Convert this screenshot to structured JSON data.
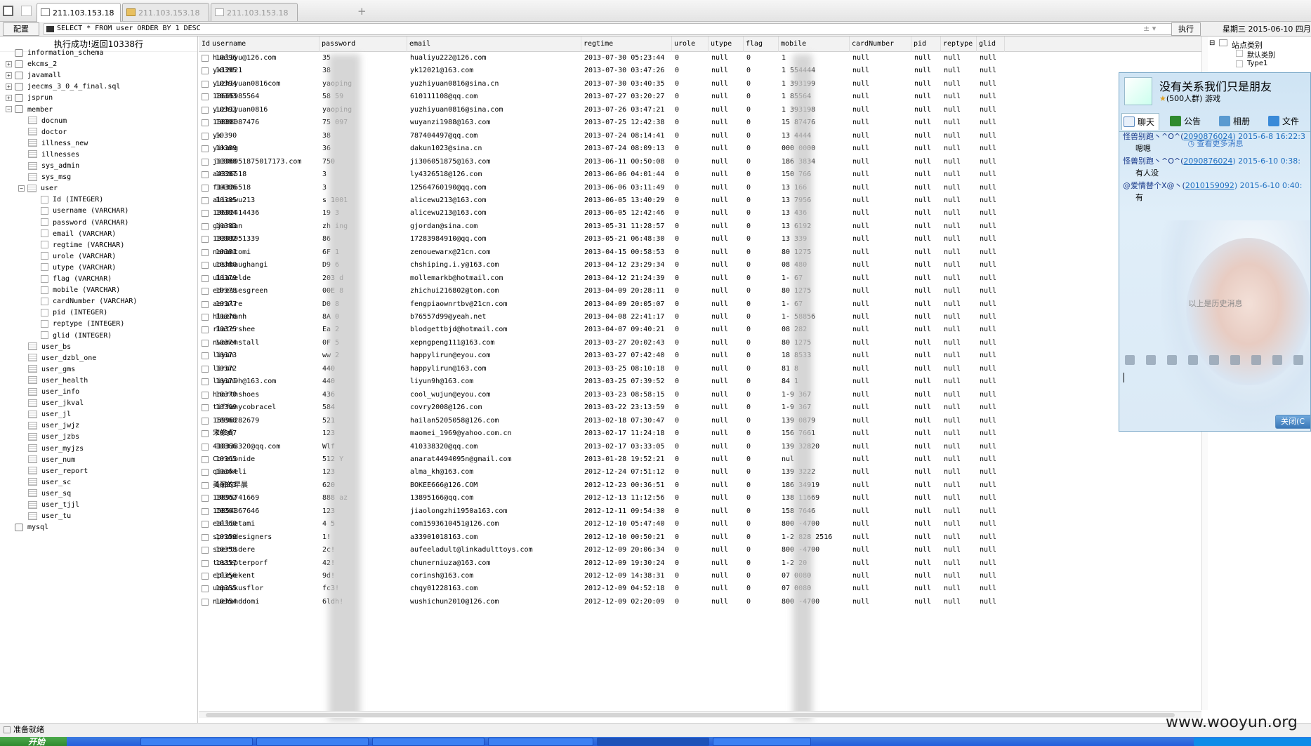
{
  "tabs": [
    {
      "label": "211.103.153.18"
    },
    {
      "label": "211.103.153.18"
    },
    {
      "label": "211.103.153.18"
    }
  ],
  "new_tab": "+",
  "toolbar": {
    "config_label": "配置",
    "sql": "SELECT * FROM user ORDER BY 1 DESC",
    "sql_controls": "± ▾",
    "execute_label": "执行",
    "datetime": "星期三  2015-06-10  四月"
  },
  "left": {
    "exec_result": "执行成功!返回10338行",
    "tree": [
      {
        "label": "information_schema",
        "level": 0,
        "kind": "db",
        "exp": ""
      },
      {
        "label": "ekcms_2",
        "level": 0,
        "kind": "db",
        "exp": "+"
      },
      {
        "label": "javamall",
        "level": 0,
        "kind": "db",
        "exp": "+"
      },
      {
        "label": "jeecms_3_0_4_final.sql",
        "level": 0,
        "kind": "db",
        "exp": "+"
      },
      {
        "label": "jsprun",
        "level": 0,
        "kind": "db",
        "exp": "+"
      },
      {
        "label": "member",
        "level": 0,
        "kind": "db",
        "exp": "−"
      },
      {
        "label": "docnum",
        "level": 1,
        "kind": "tbl"
      },
      {
        "label": "doctor",
        "level": 1,
        "kind": "tbl"
      },
      {
        "label": "illness_new",
        "level": 1,
        "kind": "tbl"
      },
      {
        "label": "illnesses",
        "level": 1,
        "kind": "tbl"
      },
      {
        "label": "sys_admin",
        "level": 1,
        "kind": "tbl"
      },
      {
        "label": "sys_msg",
        "level": 1,
        "kind": "tbl"
      },
      {
        "label": "user",
        "level": 1,
        "kind": "tbl",
        "exp": "−"
      },
      {
        "label": "Id (INTEGER)",
        "level": 2,
        "kind": "col"
      },
      {
        "label": "username (VARCHAR)",
        "level": 2,
        "kind": "col"
      },
      {
        "label": "password (VARCHAR)",
        "level": 2,
        "kind": "col"
      },
      {
        "label": "email (VARCHAR)",
        "level": 2,
        "kind": "col"
      },
      {
        "label": "regtime (VARCHAR)",
        "level": 2,
        "kind": "col"
      },
      {
        "label": "urole (VARCHAR)",
        "level": 2,
        "kind": "col"
      },
      {
        "label": "utype (VARCHAR)",
        "level": 2,
        "kind": "col"
      },
      {
        "label": "flag (VARCHAR)",
        "level": 2,
        "kind": "col"
      },
      {
        "label": "mobile (VARCHAR)",
        "level": 2,
        "kind": "col"
      },
      {
        "label": "cardNumber (VARCHAR)",
        "level": 2,
        "kind": "col"
      },
      {
        "label": "pid (INTEGER)",
        "level": 2,
        "kind": "col"
      },
      {
        "label": "reptype (INTEGER)",
        "level": 2,
        "kind": "col"
      },
      {
        "label": "glid (INTEGER)",
        "level": 2,
        "kind": "col"
      },
      {
        "label": "user_bs",
        "level": 1,
        "kind": "tbl"
      },
      {
        "label": "user_dzbl_one",
        "level": 1,
        "kind": "tbl"
      },
      {
        "label": "user_gms",
        "level": 1,
        "kind": "tbl"
      },
      {
        "label": "user_health",
        "level": 1,
        "kind": "tbl"
      },
      {
        "label": "user_info",
        "level": 1,
        "kind": "tbl"
      },
      {
        "label": "user_jkval",
        "level": 1,
        "kind": "tbl"
      },
      {
        "label": "user_jl",
        "level": 1,
        "kind": "tbl"
      },
      {
        "label": "user_jwjz",
        "level": 1,
        "kind": "tbl"
      },
      {
        "label": "user_jzbs",
        "level": 1,
        "kind": "tbl"
      },
      {
        "label": "user_myjzs",
        "level": 1,
        "kind": "tbl"
      },
      {
        "label": "user_num",
        "level": 1,
        "kind": "tbl"
      },
      {
        "label": "user_report",
        "level": 1,
        "kind": "tbl"
      },
      {
        "label": "user_sc",
        "level": 1,
        "kind": "tbl"
      },
      {
        "label": "user_sq",
        "level": 1,
        "kind": "tbl"
      },
      {
        "label": "user_tjjl",
        "level": 1,
        "kind": "tbl"
      },
      {
        "label": "user_tu",
        "level": 1,
        "kind": "tbl"
      },
      {
        "label": "mysql",
        "level": 0,
        "kind": "db",
        "exp": ""
      }
    ]
  },
  "grid": {
    "columns": [
      "Id",
      "username",
      "password",
      "email",
      "regtime",
      "urole",
      "utype",
      "flag",
      "mobile",
      "cardNumber",
      "pid",
      "reptype",
      "glid"
    ],
    "rows": [
      [
        "10396",
        "hualiyu@126.com",
        "35",
        "hualiyu222@126.com",
        "2013-07-30 05:23:44",
        "0",
        "null",
        "0",
        "1",
        "null",
        "null",
        "null",
        "null"
      ],
      [
        "10395",
        "yk12021",
        "38",
        "yk12021@163.com",
        "2013-07-30 03:47:26",
        "0",
        "null",
        "0",
        "1 554444",
        "null",
        "null",
        "null",
        "null"
      ],
      [
        "10394",
        "yuzhiyuan0816com",
        "yaoping",
        "yuzhiyuan0816@sina.cn",
        "2013-07-30 03:40:35",
        "0",
        "null",
        "0",
        "1 393199",
        "null",
        "null",
        "null",
        "null"
      ],
      [
        "10393",
        "18665985564",
        "58 59",
        "610111108@qq.com",
        "2013-07-27 03:20:27",
        "0",
        "null",
        "0",
        "1 85564",
        "null",
        "null",
        "null",
        "null"
      ],
      [
        "10392",
        "yuzhiyuan0816",
        "yaoping",
        "yuzhiyuan0816@sina.com",
        "2013-07-26 03:47:21",
        "0",
        "null",
        "0",
        "1 393198",
        "null",
        "null",
        "null",
        "null"
      ],
      [
        "10391",
        "15888087476",
        "75 097",
        "wuyanzi1988@163.com",
        "2013-07-25 12:42:38",
        "0",
        "null",
        "0",
        "15 87476",
        "null",
        "null",
        "null",
        "null"
      ],
      [
        "10390",
        "yk",
        "38",
        "787404497@qq.com",
        "2013-07-24 08:14:41",
        "0",
        "null",
        "0",
        "13 4444",
        "null",
        "null",
        "null",
        "null"
      ],
      [
        "10389",
        "yikang",
        "36",
        "dakun1023@sina.cn",
        "2013-07-24 08:09:13",
        "0",
        "null",
        "0",
        "000 0000",
        "null",
        "null",
        "null",
        "null"
      ],
      [
        "10388",
        "ji306051875017173.com",
        "750",
        "ji306051875@163.com",
        "2013-06-11 00:50:08",
        "0",
        "null",
        "0",
        "186 3834",
        "null",
        "null",
        "null",
        "null"
      ],
      [
        "10387",
        "a4326518",
        "3",
        "ly4326518@126.com",
        "2013-06-06 04:01:44",
        "0",
        "null",
        "0",
        "150 766",
        "null",
        "null",
        "null",
        "null"
      ],
      [
        "10386",
        "f14326518",
        "3",
        "12564760190@qq.com",
        "2013-06-06 03:11:49",
        "0",
        "null",
        "0",
        "13 166",
        "null",
        "null",
        "null",
        "null"
      ],
      [
        "10385",
        "alicewu213",
        "s 1001",
        "alicewu213@163.com",
        "2013-06-05 13:40:29",
        "0",
        "null",
        "0",
        "13 7956",
        "null",
        "null",
        "null",
        "null"
      ],
      [
        "10384",
        "13602414436",
        "19 3",
        "alicewu213@163.com",
        "2013-06-05 12:42:46",
        "0",
        "null",
        "0",
        "13 436",
        "null",
        "null",
        "null",
        "null"
      ],
      [
        "10383",
        "gjordan",
        "zh ing",
        "gjordan@sina.com",
        "2013-05-31 11:28:57",
        "0",
        "null",
        "0",
        "13 6192",
        "null",
        "null",
        "null",
        "null"
      ],
      [
        "10382",
        "13303051339",
        "86",
        "17283984910@qq.com",
        "2013-05-21 06:48:30",
        "0",
        "null",
        "0",
        "13 339",
        "null",
        "null",
        "null",
        "null"
      ],
      [
        "10381",
        "nanantomi",
        "6F 1",
        "zenouewarx@21cn.com",
        "2013-04-15 00:58:53",
        "0",
        "null",
        "0",
        "80 1275",
        "null",
        "null",
        "null",
        "null"
      ],
      [
        "10380",
        "uoshbaughangi",
        "D9 6",
        "chshiping.i.y@163.com",
        "2013-04-12 23:29:34",
        "0",
        "null",
        "0",
        "08 480",
        "null",
        "null",
        "null",
        "null"
      ],
      [
        "10379",
        "uliauelde",
        "203 d",
        "mollemarkb@hotmail.com",
        "2013-04-12 21:24:39",
        "0",
        "null",
        "0",
        "1- 67",
        "null",
        "null",
        "null",
        "null"
      ],
      [
        "10378",
        "edressesgreen",
        "00E 8",
        "zhichui216802@tom.com",
        "2013-04-09 20:28:11",
        "0",
        "null",
        "0",
        "80 1275",
        "null",
        "null",
        "null",
        "null"
      ],
      [
        "10377",
        "aeralre",
        "D0 8",
        "fengpiaownrtbv@21cn.com",
        "2013-04-09 20:05:07",
        "0",
        "null",
        "0",
        "1- 67",
        "null",
        "null",
        "null",
        "null"
      ],
      [
        "10376",
        "hluehanh",
        "8A 0",
        "b76557d99@yeah.net",
        "2013-04-08 22:41:17",
        "0",
        "null",
        "0",
        "1- 58856",
        "null",
        "null",
        "null",
        "null"
      ],
      [
        "10375",
        "rlatershee",
        "Ea 2",
        "blodgettbjd@hotmail.com",
        "2013-04-07 09:40:21",
        "0",
        "null",
        "0",
        "08 282",
        "null",
        "null",
        "null",
        "null"
      ],
      [
        "10374",
        "nwomenstall",
        "0F 5",
        "xepngpeng111@163.com",
        "2013-03-27 20:02:43",
        "0",
        "null",
        "0",
        "80 1275",
        "null",
        "null",
        "null",
        "null"
      ],
      [
        "10373",
        "liyun",
        "ww 2",
        "happylirun@eyou.com",
        "2013-03-27 07:42:40",
        "0",
        "null",
        "0",
        "18 8533",
        "null",
        "null",
        "null",
        "null"
      ],
      [
        "10372",
        "lirun",
        "440",
        "happylirun@163.com",
        "2013-03-25 08:10:18",
        "0",
        "null",
        "0",
        "81 8",
        "null",
        "null",
        "null",
        "null"
      ],
      [
        "10371",
        "liyun9h@163.com",
        "440",
        "liyun9h@163.com",
        "2013-03-25 07:39:52",
        "0",
        "null",
        "0",
        "84 1",
        "null",
        "null",
        "null",
        "null"
      ],
      [
        "10370",
        "hnorthshoes",
        "436",
        "cool_wujun@eyou.com",
        "2013-03-23 08:58:15",
        "0",
        "null",
        "0",
        "1-9 367",
        "null",
        "null",
        "null",
        "null"
      ],
      [
        "10369",
        "tiffanycobracel",
        "584",
        "covry2008@126.com",
        "2013-03-22 23:13:59",
        "0",
        "null",
        "0",
        "1-9 367",
        "null",
        "null",
        "null",
        "null"
      ],
      [
        "10368",
        "15996282679",
        "521",
        "hailan5205058@126.com",
        "2013-02-18 07:30:47",
        "0",
        "null",
        "0",
        "139 0879",
        "null",
        "null",
        "null",
        "null"
      ],
      [
        "10367",
        "宋修贞",
        "123",
        "maomei_1969@yahoo.com.cn",
        "2013-02-17 11:24:18",
        "0",
        "null",
        "0",
        "156 7661",
        "null",
        "null",
        "null",
        "null"
      ],
      [
        "10366",
        "410338320@qq.com",
        "Wlf",
        "410338320@qq.com",
        "2013-02-17 03:33:05",
        "0",
        "null",
        "0",
        "139 32820",
        "null",
        "null",
        "null",
        "null"
      ],
      [
        "10365",
        "Coreionide",
        "512 Y",
        "anarat4494095n@gmail.com",
        "2013-01-28 19:52:21",
        "0",
        "null",
        "0",
        "nul",
        "null",
        "null",
        "null",
        "null"
      ],
      [
        "10364",
        "qiaokeli",
        "123",
        "alma_kh@163.com",
        "2012-12-24 07:51:12",
        "0",
        "null",
        "0",
        "139 3222",
        "null",
        "null",
        "null",
        "null"
      ],
      [
        "10363",
        "美丽的早晨",
        "620",
        "BOKEE666@126.COM",
        "2012-12-23 00:36:51",
        "0",
        "null",
        "0",
        "186 34919",
        "null",
        "null",
        "null",
        "null"
      ],
      [
        "10362",
        "13895741669",
        "888 az",
        "13895166@qq.com",
        "2012-12-13 11:12:56",
        "0",
        "null",
        "0",
        "138 11669",
        "null",
        "null",
        "null",
        "null"
      ],
      [
        "10361",
        "15854867646",
        "123",
        "jiaolongzhi1950a163.com",
        "2012-12-11 09:54:30",
        "0",
        "null",
        "0",
        "158 7646",
        "null",
        "null",
        "null",
        "null"
      ],
      [
        "10360",
        "eallietami",
        "4 5",
        "com1593610451@126.com",
        "2012-12-10 05:47:40",
        "0",
        "null",
        "0",
        "800 -4700",
        "null",
        "null",
        "null",
        "null"
      ],
      [
        "10359",
        "spromdesigners",
        "1!",
        "a33901018163.com",
        "2012-12-10 00:50:21",
        "0",
        "null",
        "0",
        "1-2 828 2516",
        "null",
        "null",
        "null",
        "null"
      ],
      [
        "10358",
        "sbertsdere",
        "2c!",
        "aufeeladult@linkadulttoys.com",
        "2012-12-09 20:06:34",
        "0",
        "null",
        "0",
        "800 -4700",
        "null",
        "null",
        "null",
        "null"
      ],
      [
        "10357",
        "tostepterporf",
        "42!",
        "chunerniuza@163.com",
        "2012-12-09 19:30:24",
        "0",
        "null",
        "0",
        "1-2 20",
        "null",
        "null",
        "null",
        "null"
      ],
      [
        "10356",
        "epleyekent",
        "9d!",
        "corinsh@163.com",
        "2012-12-09 14:38:31",
        "0",
        "null",
        "0",
        "07 0080",
        "null",
        "null",
        "null",
        "null"
      ],
      [
        "10355",
        "uaposkusflor",
        "fc3!",
        "chqy01228163.com",
        "2012-12-09 04:52:18",
        "0",
        "null",
        "0",
        "07 0080",
        "null",
        "null",
        "null",
        "null"
      ],
      [
        "10354",
        "nuehanddomi",
        "6ldh!",
        "wushichun2010@126.com",
        "2012-12-09 02:20:09",
        "0",
        "null",
        "0",
        "800 -4700",
        "null",
        "null",
        "null",
        "null"
      ]
    ]
  },
  "right_panel": {
    "title": "站点类别",
    "items": [
      "默认类别",
      "Type1"
    ]
  },
  "chat": {
    "group_name": "没有关系我们只是朋友",
    "group_sub": "(500人群) 游戏",
    "tabs": [
      "聊天",
      "公告",
      "相册",
      "文件"
    ],
    "more": "查看更多消息",
    "messages": [
      {
        "sender": "怪兽别跑丶^O^(",
        "qq": "2090876024",
        "time": ") 2015-6-8 16:22:3",
        "text": "嗯嗯"
      },
      {
        "sender": "怪兽别跑丶^O^(",
        "qq": "2090876024",
        "time": ") 2015-6-10 0:38:",
        "text": "有人没"
      },
      {
        "sender": "@爱情替个X@丶(",
        "qq": "2010159092",
        "time": ") 2015-6-10 0:40:",
        "text": "有"
      }
    ],
    "history": "以上是历史消息",
    "close_label": "关闭(C"
  },
  "status": "准备就绪",
  "taskbar": {
    "start": "开始"
  },
  "watermark": "www.wooyun.org"
}
